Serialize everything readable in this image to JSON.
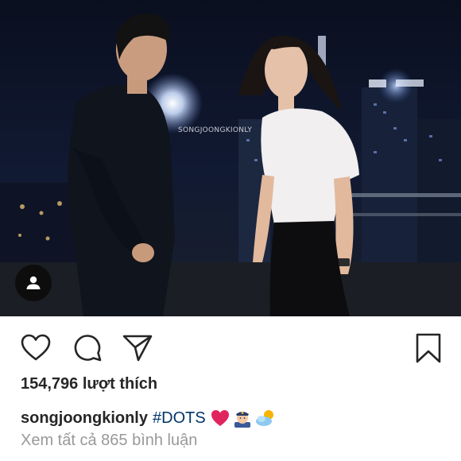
{
  "post": {
    "watermark": "SONGJOONGKIONLY",
    "likes_text": "154,796 lượt thích",
    "caption": {
      "username": "songjoongkionly",
      "hashtag": "#DOTS",
      "emojis": [
        "red-heart-emoji",
        "police-officer-emoji",
        "sun-behind-cloud-emoji"
      ]
    },
    "view_comments_text": "Xem tất cả 865 bình luận"
  },
  "actions": {
    "like_icon": "heart-icon",
    "comment_icon": "speech-bubble-icon",
    "share_icon": "paper-plane-icon",
    "save_icon": "bookmark-icon",
    "tag_icon": "user-tag-icon"
  },
  "colors": {
    "text": "#262626",
    "hashtag": "#003569",
    "muted": "#999999",
    "heart": "#e0245e"
  }
}
